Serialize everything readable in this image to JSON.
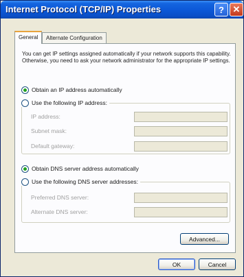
{
  "window": {
    "title": "Internet Protocol (TCP/IP) Properties",
    "help_glyph": "?",
    "close_glyph": "✕"
  },
  "tabs": [
    {
      "label": "General",
      "selected": true
    },
    {
      "label": "Alternate Configuration",
      "selected": false
    }
  ],
  "info_text": "You can get IP settings assigned automatically if your network supports this capability. Otherwise, you need to ask your network administrator for the appropriate IP settings.",
  "ip_options": {
    "auto_label": "Obtain an IP address automatically",
    "auto_selected": true,
    "manual_label": "Use the following IP address:",
    "manual_selected": false,
    "fields": [
      {
        "label": "IP address:",
        "value": ""
      },
      {
        "label": "Subnet mask:",
        "value": ""
      },
      {
        "label": "Default gateway:",
        "value": ""
      }
    ]
  },
  "dns_options": {
    "auto_label": "Obtain DNS server address automatically",
    "auto_selected": true,
    "manual_label": "Use the following DNS server addresses:",
    "manual_selected": false,
    "fields": [
      {
        "label": "Preferred DNS server:",
        "value": ""
      },
      {
        "label": "Alternate DNS server:",
        "value": ""
      }
    ]
  },
  "buttons": {
    "advanced": "Advanced...",
    "ok": "OK",
    "cancel": "Cancel"
  },
  "colors": {
    "titlebar": "#0b57d6",
    "dialog_bg": "#ece9d8",
    "radio_selected": "#21a121",
    "tab_highlight": "#e8a33b"
  }
}
